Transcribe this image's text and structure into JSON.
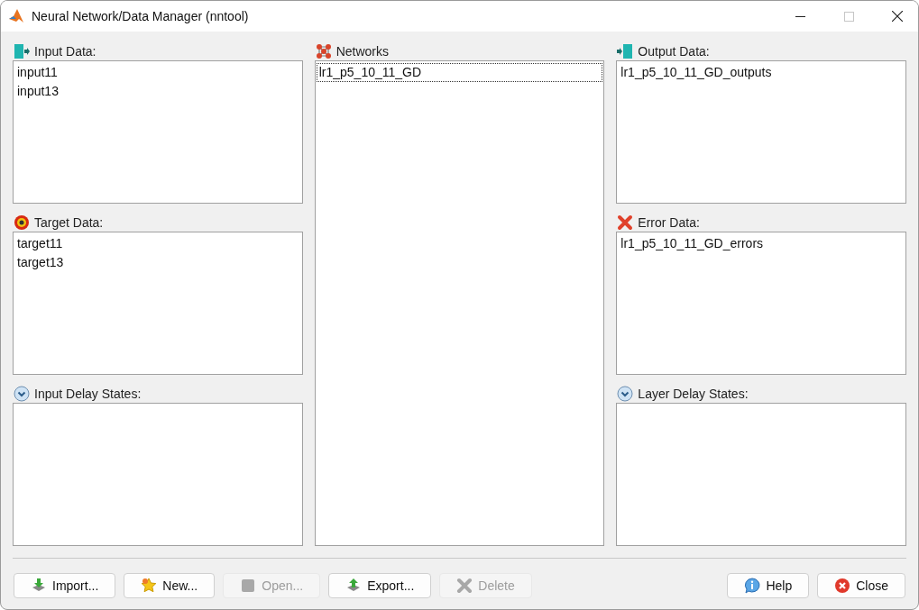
{
  "window": {
    "title": "Neural Network/Data Manager (nntool)"
  },
  "columns": [
    {
      "panels": [
        {
          "kind": "input",
          "label": "Input Data:",
          "items": [
            {
              "text": "input11",
              "focused": false
            },
            {
              "text": "input13",
              "focused": false
            }
          ]
        },
        {
          "kind": "target",
          "label": "Target Data:",
          "items": [
            {
              "text": "target11",
              "focused": false
            },
            {
              "text": "target13",
              "focused": false
            }
          ]
        },
        {
          "kind": "delay",
          "label": "Input Delay States:"
        }
      ]
    },
    {
      "panels": [
        {
          "kind": "network",
          "label": "Networks",
          "items": [
            {
              "text": "lr1_p5_10_11_GD",
              "focused": true
            }
          ]
        }
      ]
    },
    {
      "panels": [
        {
          "kind": "output",
          "label": "Output Data:",
          "items": [
            {
              "text": "lr1_p5_10_11_GD_outputs",
              "focused": false
            }
          ]
        },
        {
          "kind": "error",
          "label": "Error Data:",
          "items": [
            {
              "text": "lr1_p5_10_11_GD_errors",
              "focused": false
            }
          ]
        },
        {
          "kind": "delay",
          "label": "Layer Delay States:"
        }
      ]
    }
  ],
  "buttons_left": [
    {
      "kind": "import",
      "label": "Import...",
      "disabled": false
    },
    {
      "kind": "new",
      "label": "New...",
      "disabled": false
    },
    {
      "kind": "open",
      "label": "Open...",
      "disabled": true
    },
    {
      "kind": "export",
      "label": "Export...",
      "disabled": false
    },
    {
      "kind": "delete",
      "label": "Delete",
      "disabled": true
    }
  ],
  "buttons_right": [
    {
      "kind": "help",
      "label": "Help",
      "disabled": false
    },
    {
      "kind": "close",
      "label": "Close",
      "disabled": false
    }
  ]
}
